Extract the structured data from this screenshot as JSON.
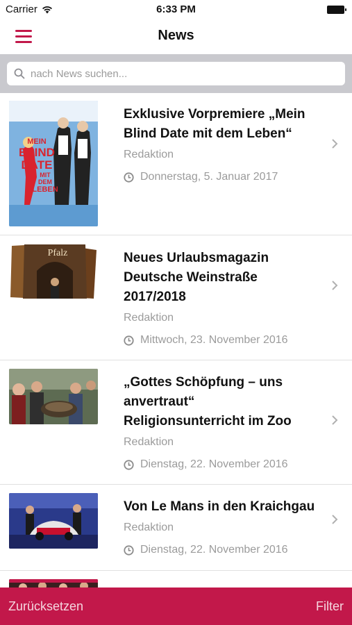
{
  "status_bar": {
    "carrier": "Carrier",
    "time": "6:33 PM"
  },
  "nav": {
    "title": "News"
  },
  "search": {
    "placeholder": "nach News suchen..."
  },
  "articles": [
    {
      "headline": "Exklusive Vorpremiere „Mein Blind Date mit dem Leben“",
      "author": "Redaktion",
      "date": "Donnerstag, 5. Januar 2017",
      "poster_text": [
        "MEIN",
        "BLIND",
        "DATE",
        "MIT",
        "DEM",
        "LEBEN"
      ]
    },
    {
      "headline": "Neues Urlaubsmagazin Deutsche Weinstraße 2017/2018",
      "author": "Redaktion",
      "date": "Mittwoch, 23. November 2016",
      "magazine_text": "Pfalz"
    },
    {
      "headline": "„Gottes Schöpfung – uns anvertraut“ Religionsunterricht im Zoo",
      "author": "Redaktion",
      "date": "Dienstag, 22. November 2016"
    },
    {
      "headline": "Von Le Mans in den Kraichgau",
      "author": "Redaktion",
      "date": "Dienstag, 22. November 2016"
    }
  ],
  "bottom_bar": {
    "reset_label": "Zurücksetzen",
    "filter_label": "Filter"
  },
  "colors": {
    "accent": "#c2184a",
    "muted": "#9b9b9b",
    "search_bg": "#c9c9ce"
  }
}
